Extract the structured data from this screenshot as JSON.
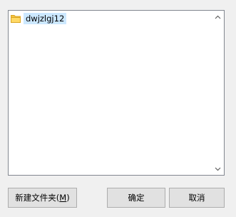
{
  "tree": {
    "items": [
      {
        "label": "dwjzlgj12",
        "icon": "folder-icon",
        "selected": true
      }
    ]
  },
  "buttons": {
    "new_folder_label": "新建文件夹(",
    "new_folder_accel": "M",
    "new_folder_suffix": ")",
    "ok_label": "确定",
    "cancel_label": "取消"
  },
  "colors": {
    "selection": "#cce8ff",
    "dialog_bg": "#f0f0f0",
    "folder": "#f5c342"
  }
}
